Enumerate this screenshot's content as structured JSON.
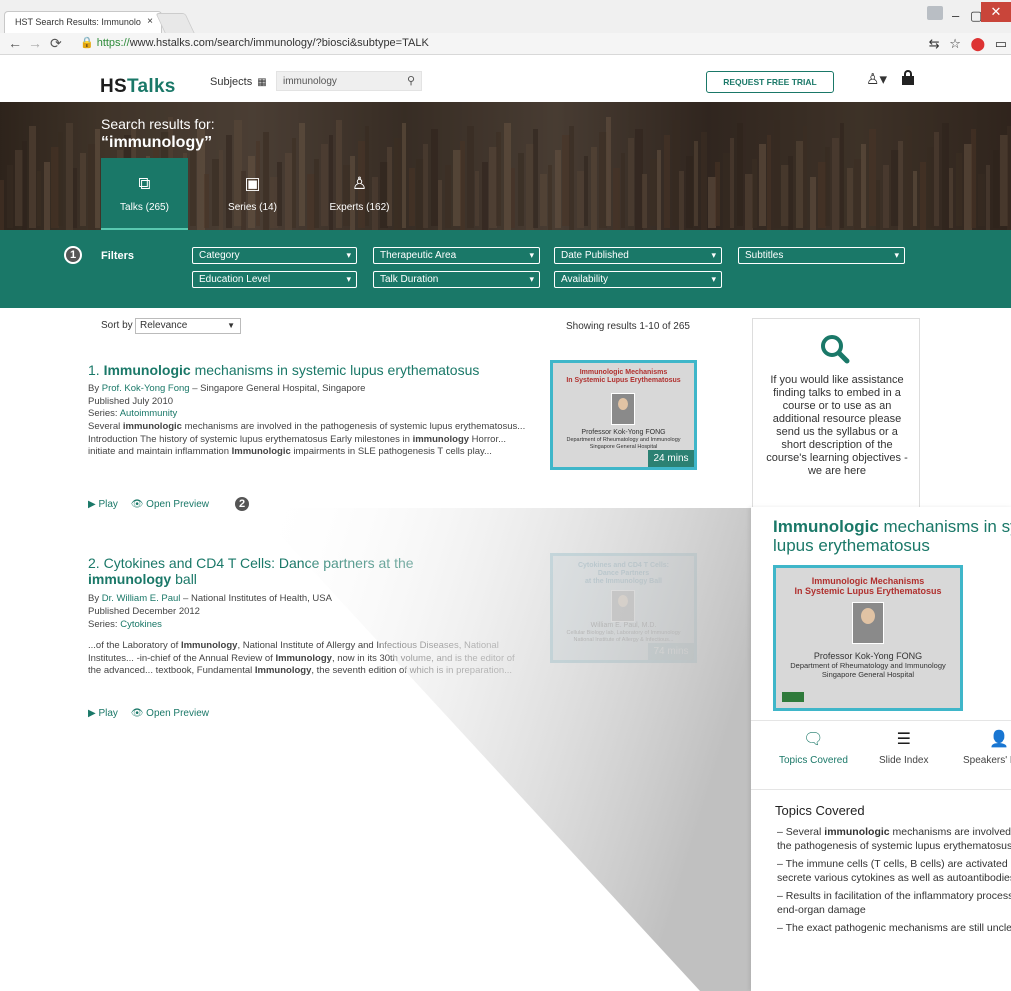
{
  "browser": {
    "tab_title": "HST Search Results: Immunolo",
    "tab_close": "×",
    "url_scheme": "https://",
    "url_rest": "www.hstalks.com/search/immunology/?biosci&subtype=TALK"
  },
  "header": {
    "logo_hs": "HS",
    "logo_talks": "Talks",
    "subjects_label": "Subjects",
    "search_value": "immunology",
    "trial_button": "REQUEST FREE TRIAL"
  },
  "hero": {
    "line1": "Search results for:",
    "line2": "“immunology”",
    "tabs": [
      {
        "label": "Talks (265)",
        "icon": "play-square-icon"
      },
      {
        "label": "Series (14)",
        "icon": "series-icon"
      },
      {
        "label": "Experts (162)",
        "icon": "expert-icon"
      }
    ]
  },
  "filters": {
    "badge": "1",
    "label": "Filters",
    "row1": [
      "Category",
      "Therapeutic Area",
      "Date Published",
      "Subtitles"
    ],
    "row2": [
      "Education Level",
      "Talk Duration",
      "Availability"
    ]
  },
  "sort": {
    "label": "Sort by",
    "value": "Relevance",
    "showing": "Showing results 1-10 of 265"
  },
  "results": [
    {
      "title_num": "1. ",
      "title_bold": "Immunologic",
      "title_rest": " mechanisms in systemic lupus erythematosus",
      "by_prefix": "By ",
      "author": "Prof. Kok-Yong Fong",
      "affiliation": " – Singapore General Hospital, Singapore",
      "published": "Published July 2010",
      "series_prefix": "Series: ",
      "series": "Autoimmunity",
      "desc": [
        {
          "t": "Several "
        },
        {
          "b": "immunologic"
        },
        {
          "t": " mechanisms are involved in the pathogenesis of systemic lupus erythematosus... Introduction The history of systemic lupus erythematosus Early milestones in "
        },
        {
          "b": "immunology"
        },
        {
          "t": " Horror... initiate and maintain inflammation "
        },
        {
          "b": "Immunologic"
        },
        {
          "t": " impairments in SLE pathogenesis T cells play..."
        }
      ],
      "play": "▶ Play",
      "preview": "👁 Open Preview",
      "thumb_title": "Immunologic Mechanisms\nIn Systemic Lupus Erythematosus",
      "thumb_speaker": "Professor Kok-Yong FONG",
      "thumb_dept": "Department of Rheumatology and Immunology\nSingapore General Hospital",
      "duration": "24 mins"
    },
    {
      "title_num": "2. ",
      "title_line1": "Cytokines and CD4 T Cells: Dance partners at the",
      "title_bold": "immunology",
      "title_rest": " ball",
      "by_prefix": "By ",
      "author": "Dr. William E. Paul",
      "affiliation": " – National Institutes of Health, USA",
      "published": "Published December 2012",
      "series_prefix": "Series: ",
      "series": "Cytokines",
      "desc": [
        {
          "t": "...of the Laboratory of "
        },
        {
          "b": "Immunology"
        },
        {
          "t": ", National Institute of Allergy and Infectious Diseases, National Institutes... -in-chief of the Annual Review of "
        },
        {
          "b": "Immunology"
        },
        {
          "t": ", now in its 30th volume, and is the editor of the advanced... textbook, Fundamental "
        },
        {
          "b": "Immunology"
        },
        {
          "t": ", the seventh edition of which is in preparation..."
        }
      ],
      "play": "▶ Play",
      "preview": "👁 Open Preview",
      "thumb_title": "Cytokines and CD4 T Cells:\nDance Partners\nat the Immunology Ball",
      "thumb_speaker": "William E. Paul, M.D.",
      "thumb_dept": "Cellular Biology lab, Laboratory of Immunology\nNational Institute of Allergy & Infectious...",
      "duration": "74 mins"
    }
  ],
  "step2_badge": "2",
  "help_box": {
    "text": "If you would like assistance finding talks to embed in a course or to use as an additional resource please send us the syllabus or a short description of the course's learning objectives - we are here"
  },
  "preview": {
    "title_bold": "Immunologic",
    "title_rest": " mechanisms in systemic lupus erythematosus",
    "thumb_title": "Immunologic Mechanisms\nIn Systemic Lupus Erythematosus",
    "thumb_speaker": "Professor Kok-Yong FONG",
    "thumb_dept": "Department of Rheumatology and Immunology\nSingapore General Hospital",
    "tabs": [
      {
        "label": "Topics Covered",
        "icon": "chat-bubbles-icon"
      },
      {
        "label": "Slide Index",
        "icon": "list-icon"
      },
      {
        "label": "Speakers' Biography",
        "icon": "person-icon"
      }
    ],
    "section": "Topics Covered",
    "items": [
      [
        {
          "t": "– Several "
        },
        {
          "b": "immunologic"
        },
        {
          "t": " mechanisms are involved in the pathogenesis of systemic lupus erythematosus"
        }
      ],
      [
        {
          "t": "– The immune cells (T cells, B cells) are activated and secrete various cytokines as well as autoantibodies"
        }
      ],
      [
        {
          "t": "– Results in facilitation of the inflammatory process and end-organ damage"
        }
      ],
      [
        {
          "t": "– The exact pathogenic mechanisms are still unclear"
        }
      ]
    ]
  },
  "colors": {
    "brand_teal": "#1a7868",
    "thumb_border": "#3fb6c9",
    "close_red": "#c9453a"
  }
}
